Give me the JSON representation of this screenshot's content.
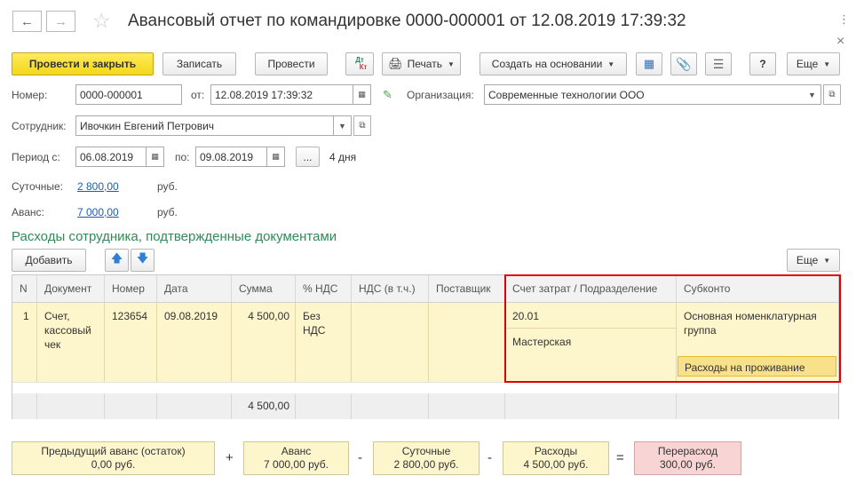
{
  "header": {
    "title": "Авансовый отчет по командировке 0000-000001 от 12.08.2019 17:39:32",
    "back_icon": "arrow-left",
    "forward_icon": "arrow-right",
    "favorite_icon": "star"
  },
  "window_controls": {
    "menu": "⋮",
    "close": "×"
  },
  "toolbar": {
    "post_close": "Провести и закрыть",
    "save": "Записать",
    "post": "Провести",
    "dtkt_top": "Дт",
    "dtkt_bottom": "Кт",
    "print": "Печать",
    "create_based": "Создать на основании",
    "help": "?",
    "more": "Еще"
  },
  "form": {
    "number_label": "Номер:",
    "number_value": "0000-000001",
    "date_label": "от:",
    "date_value": "12.08.2019 17:39:32",
    "org_label": "Организация:",
    "org_value": "Современные технологии ООО",
    "employee_label": "Сотрудник:",
    "employee_value": "Ивочкин Евгений Петрович",
    "period_label": "Период с:",
    "period_from": "06.08.2019",
    "period_to_label": "по:",
    "period_to": "09.08.2019",
    "ellipsis": "...",
    "days": "4 дня",
    "per_diem_label": "Суточные:",
    "per_diem_value": "2 800,00",
    "per_diem_unit": "руб.",
    "advance_label": "Аванс:",
    "advance_value": "7 000,00",
    "advance_unit": "руб."
  },
  "section": {
    "title": "Расходы сотрудника, подтвержденные документами",
    "add": "Добавить",
    "more": "Еще"
  },
  "table": {
    "headers": {
      "n": "N",
      "doc": "Документ",
      "num": "Номер",
      "date": "Дата",
      "sum": "Сумма",
      "vat_pct": "% НДС",
      "vat": "НДС (в т.ч.)",
      "supplier": "Поставщик",
      "account": "Счет затрат / Подразделение",
      "subconto": "Субконто"
    },
    "row": {
      "n": "1",
      "doc": "Счет, кассовый чек",
      "num": "123654",
      "date": "09.08.2019",
      "sum": "4 500,00",
      "vat_pct": "Без НДС",
      "vat": "",
      "supplier": "",
      "account": "20.01",
      "department": "Мастерская",
      "subconto1": "Основная номенклатурная группа",
      "subconto2": "Расходы на проживание"
    },
    "footer_sum": "4 500,00"
  },
  "summary": {
    "prev_label": "Предыдущий аванс (остаток)",
    "prev_value": "0,00 руб.",
    "advance_label": "Аванс",
    "advance_value": "7 000,00 руб.",
    "per_diem_label": "Суточные",
    "per_diem_value": "2 800,00 руб.",
    "expenses_label": "Расходы",
    "expenses_value": "4 500,00 руб.",
    "overspend_label": "Перерасход",
    "overspend_value": "300,00 руб.",
    "op_plus": "+",
    "op_minus1": "-",
    "op_minus2": "-",
    "op_eq": "="
  },
  "colors": {
    "primary_button": "#f4d61a",
    "row_highlight": "#fdf5cc",
    "section_title": "#2e8b57",
    "link": "#1f5ea8",
    "highlight_frame": "#e00000",
    "overspend": "#f8d4d4"
  }
}
